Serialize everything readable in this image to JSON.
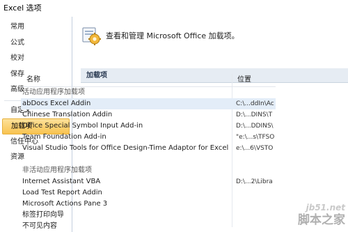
{
  "window": {
    "title": "Excel 选项"
  },
  "sidebar": {
    "items": [
      {
        "label": "常用",
        "name": "sidebar-item-popular"
      },
      {
        "label": "公式",
        "name": "sidebar-item-formulas"
      },
      {
        "label": "校对",
        "name": "sidebar-item-proofing"
      },
      {
        "label": "保存",
        "name": "sidebar-item-save"
      },
      {
        "label": "高级",
        "name": "sidebar-item-advanced"
      },
      {
        "label": "自定义",
        "name": "sidebar-item-customize"
      },
      {
        "label": "加载项",
        "name": "sidebar-item-addins"
      },
      {
        "label": "信任中心",
        "name": "sidebar-item-trust-center"
      },
      {
        "label": "资源",
        "name": "sidebar-item-resources"
      }
    ]
  },
  "banner": {
    "text": "查看和管理 Microsoft Office 加载项。",
    "icon": "addins-gear-icon"
  },
  "section": {
    "title": "加载项"
  },
  "table": {
    "col_name": "名称",
    "col_location": "位置",
    "active_group": "活动应用程序加载项",
    "active_rows": [
      {
        "name": "abDocs Excel Addin",
        "location": "C:\\...ddIn\\Ac"
      },
      {
        "name": "Chinese Translation Addin",
        "location": "D:\\...DINS\\T"
      },
      {
        "name": "Office Special Symbol Input Add-in",
        "location": "D:\\...DDINS\\"
      },
      {
        "name": "Team Foundation Add-in",
        "location": "\"e:\\...s\\TFSO"
      },
      {
        "name": "Visual Studio Tools for Office Design-Time Adaptor for Excel",
        "location": "e:\\...6\\VSTO"
      }
    ],
    "inactive_group": "非活动应用程序加载项",
    "inactive_rows": [
      {
        "name": "Internet Assistant VBA",
        "location": "D:\\...2\\Libra"
      },
      {
        "name": "Load Test Report Addin",
        "location": ""
      },
      {
        "name": "Microsoft Actions Pane 3",
        "location": ""
      },
      {
        "name": "标签打印向导",
        "location": ""
      },
      {
        "name": "不可见内容",
        "location": ""
      }
    ]
  },
  "watermark": {
    "line1": "jb51.net",
    "line2": "脚本之家"
  },
  "colors": {
    "active_nav": "#f8c350",
    "section_header_bg": "#e6ecf3",
    "selected_row": "#e3edf8"
  }
}
